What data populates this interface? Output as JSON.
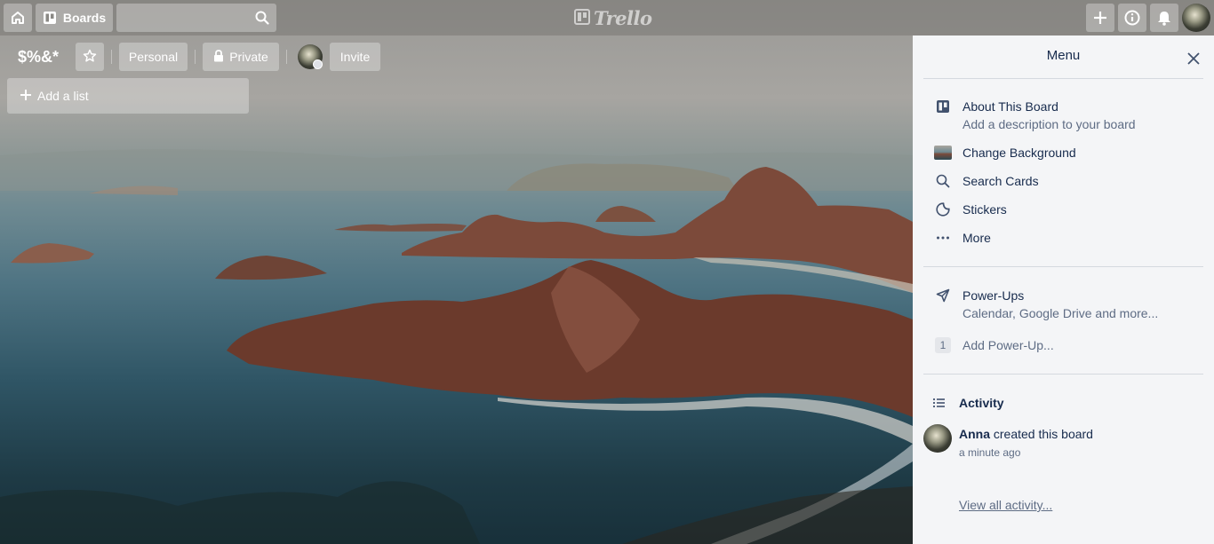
{
  "header": {
    "home_icon": "home-icon",
    "boards_label": "Boards",
    "search_value": "",
    "search_placeholder": "",
    "logo_text": "Trello",
    "add_icon": "plus-icon",
    "info_icon": "info-icon",
    "notifications_icon": "bell-icon"
  },
  "board": {
    "title": "$%&*",
    "star_icon": "star-icon",
    "team_label": "Personal",
    "visibility_label": "Private",
    "invite_label": "Invite",
    "add_list_label": "Add a list"
  },
  "menu": {
    "title": "Menu",
    "about": {
      "label": "About This Board",
      "sub": "Add a description to your board"
    },
    "change_background": {
      "label": "Change Background"
    },
    "search_cards": {
      "label": "Search Cards"
    },
    "stickers": {
      "label": "Stickers"
    },
    "more": {
      "label": "More"
    },
    "power_ups": {
      "label": "Power-Ups",
      "sub": "Calendar, Google Drive and more..."
    },
    "add_power_up": {
      "count": "1",
      "label": "Add Power-Up..."
    },
    "activity": {
      "title": "Activity",
      "entries": [
        {
          "user": "Anna",
          "action": "created this board",
          "time": "a minute ago"
        }
      ],
      "view_all": "View all activity..."
    }
  },
  "colors": {
    "menu_bg": "#f4f5f7",
    "text_primary": "#172b4d",
    "text_secondary": "#5e6c84"
  }
}
